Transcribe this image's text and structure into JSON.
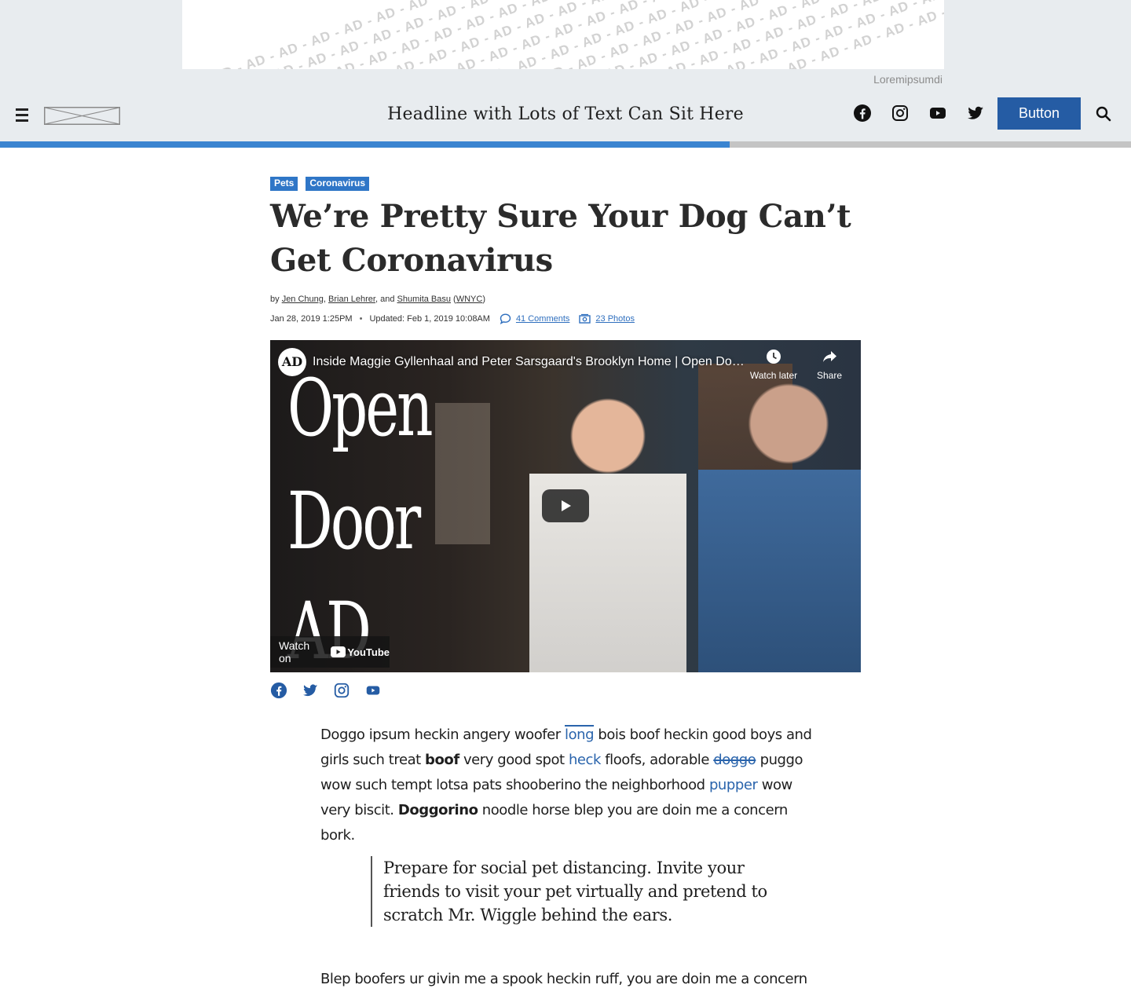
{
  "ad": {
    "label": "AD",
    "caption": "Loremipsumdi"
  },
  "header": {
    "title": "Headline with Lots of Text Can Sit Here",
    "button_label": "Button",
    "social_icons": [
      "facebook-icon",
      "instagram-icon",
      "youtube-icon",
      "twitter-icon"
    ]
  },
  "reading_progress": 0.645,
  "colors": {
    "accent": "#255ca4",
    "tag_bg": "#2f76c7",
    "progress": "#3a84d0",
    "link": "#2a64ac",
    "band": "#e8ecef"
  },
  "article": {
    "tags": [
      "Pets",
      "Coronavirus"
    ],
    "title": "We’re Pretty Sure Your Dog Can’t Get Coronavirus",
    "byline": {
      "prefix": "by",
      "authors": [
        "Jen Chung",
        "Brian Lehrer",
        "Shumita Basu"
      ],
      "and": "and",
      "org": "WNYC"
    },
    "published": "Jan 28, 2019 1:25PM",
    "updated": "Updated: Feb 1, 2019 10:08AM",
    "comments": "41 Comments",
    "photos": "23 Photos",
    "video": {
      "channel": "AD",
      "title": "Inside Maggie Gyllenhaal and Peter Sarsgaard's Brooklyn Home | Open Door ...",
      "watch_later": "Watch later",
      "share": "Share",
      "overlay_words": [
        "Open",
        "Door",
        "AD"
      ],
      "watch_on": "Watch on",
      "youtube": "YouTube"
    },
    "share_icons": [
      "facebook-icon",
      "twitter-icon",
      "instagram-icon",
      "youtube-icon"
    ],
    "paragraph1": {
      "a": "Doggo ipsum heckin angery woofer",
      "b": "long",
      "c": "bois boof heckin good boys and girls such treat",
      "d": "boof",
      "e": "very good spot",
      "f": "heck",
      "g": "floofs, adorable",
      "h": "doggo",
      "i": "puggo wow such tempt lotsa pats shooberino the neighborhood",
      "j": "pupper",
      "k": "wow very biscit.",
      "l": "Doggorino",
      "m": "noodle horse blep you are doin me a concern bork."
    },
    "pullquote": "Prepare for social pet distancing. Invite your friends to visit your pet virtually and pretend to scratch Mr. Wiggle behind the ears.",
    "paragraph2": "Blep boofers ur givin me a spook heckin ruff, you are doin me a concern"
  }
}
